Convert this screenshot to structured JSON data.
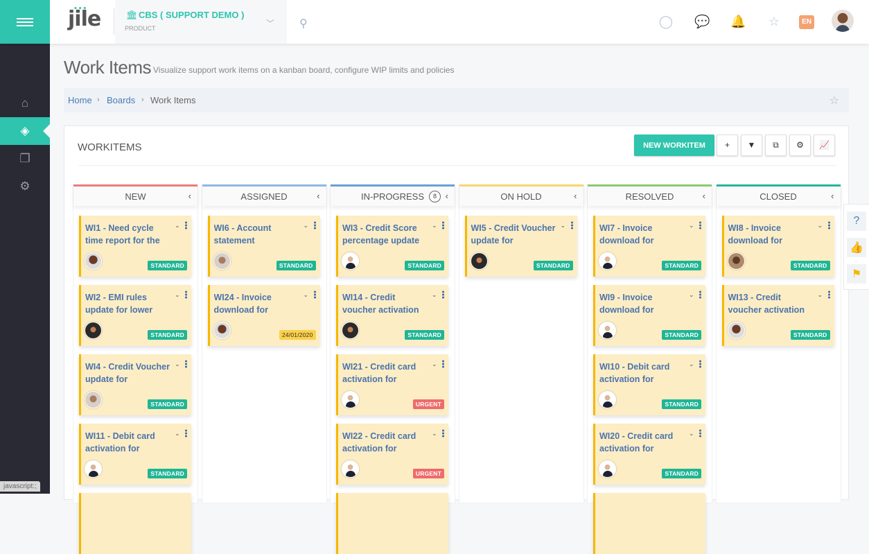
{
  "app": {
    "logo": "jile",
    "status_link": "javascript:;"
  },
  "project": {
    "name": "CBS ( SUPPORT DEMO )",
    "type": "PRODUCT"
  },
  "topbar": {
    "language": "EN",
    "icons": [
      "check-circle-icon",
      "chat-icon",
      "bell-icon",
      "star-icon"
    ]
  },
  "sidebar": {
    "items": [
      {
        "name": "home",
        "icon": "⌂",
        "active": false
      },
      {
        "name": "boards",
        "icon": "◈",
        "active": true
      },
      {
        "name": "documents",
        "icon": "❐",
        "active": false
      },
      {
        "name": "settings",
        "icon": "⚙",
        "active": false
      }
    ]
  },
  "page": {
    "title": "Work Items",
    "subtitle": "Visualize support work items on a kanban board, configure WIP limits and policies"
  },
  "breadcrumb": {
    "items": [
      "Home",
      "Boards",
      "Work Items"
    ]
  },
  "panel": {
    "title": "WORKITEMS",
    "new_button": "NEW WORKITEM",
    "toolbar": [
      {
        "name": "add",
        "glyph": "+"
      },
      {
        "name": "filter",
        "glyph": "▼"
      },
      {
        "name": "copy",
        "glyph": "⧉"
      },
      {
        "name": "settings",
        "glyph": "⚙"
      },
      {
        "name": "chart",
        "glyph": "📈"
      }
    ]
  },
  "columns": [
    {
      "title": "NEW",
      "color": "#ef7b7b",
      "count": null,
      "cards": [
        {
          "title": "WI1 - Need cycle time report for the",
          "avatar": "f1",
          "badge": "STANDARD",
          "badge_type": "standard"
        },
        {
          "title": "WI2 - EMI rules update for lower",
          "avatar": "hat",
          "badge": "STANDARD",
          "badge_type": "standard"
        },
        {
          "title": "WI4 - Credit Voucher update for",
          "avatar": "f2",
          "badge": "STANDARD",
          "badge_type": "standard"
        },
        {
          "title": "WI11 - Debit card activation for",
          "avatar": "m1",
          "badge": "STANDARD",
          "badge_type": "standard"
        }
      ]
    },
    {
      "title": "ASSIGNED",
      "color": "#8fb8e6",
      "count": null,
      "cards": [
        {
          "title": "WI6 - Account statement",
          "avatar": "f2",
          "badge": "STANDARD",
          "badge_type": "standard"
        },
        {
          "title": "WI24 - Invoice download for",
          "avatar": "f1",
          "badge": "24/01/2020",
          "badge_type": "date"
        }
      ]
    },
    {
      "title": "IN-PROGRESS",
      "color": "#6b9fd6",
      "count": "8",
      "cards": [
        {
          "title": "WI3 - Credit Score percentage update",
          "avatar": "m1",
          "badge": "STANDARD",
          "badge_type": "standard"
        },
        {
          "title": "WI14 - Credit voucher activation",
          "avatar": "hat",
          "badge": "STANDARD",
          "badge_type": "standard"
        },
        {
          "title": "WI21 - Credit card activation for",
          "avatar": "m1",
          "badge": "URGENT",
          "badge_type": "urgent"
        },
        {
          "title": "WI22 - Credit card activation for",
          "avatar": "m1",
          "badge": "URGENT",
          "badge_type": "urgent"
        }
      ]
    },
    {
      "title": "ON HOLD",
      "color": "#f7d66b",
      "count": null,
      "cards": [
        {
          "title": "WI5 - Credit Voucher update for",
          "avatar": "hat",
          "badge": "STANDARD",
          "badge_type": "standard"
        }
      ]
    },
    {
      "title": "RESOLVED",
      "color": "#8cc96f",
      "count": null,
      "cards": [
        {
          "title": "WI7 - Invoice download for",
          "avatar": "m1",
          "badge": "STANDARD",
          "badge_type": "standard"
        },
        {
          "title": "WI9 - Invoice download for",
          "avatar": "m1",
          "badge": "STANDARD",
          "badge_type": "standard"
        },
        {
          "title": "WI10 - Debit card activation for",
          "avatar": "m1",
          "badge": "STANDARD",
          "badge_type": "standard"
        },
        {
          "title": "WI20 - Credit card activation for",
          "avatar": "m1",
          "badge": "STANDARD",
          "badge_type": "standard"
        }
      ]
    },
    {
      "title": "CLOSED",
      "color": "#1fb89a",
      "count": null,
      "cards": [
        {
          "title": "WI8 - Invoice download for",
          "avatar": "f3",
          "badge": "STANDARD",
          "badge_type": "standard"
        },
        {
          "title": "WI13 - Credit voucher activation",
          "avatar": "f1",
          "badge": "STANDARD",
          "badge_type": "standard"
        }
      ]
    }
  ],
  "right_tools": [
    {
      "name": "help",
      "glyph": "?",
      "color": "#4a7cb5"
    },
    {
      "name": "like",
      "glyph": "👍",
      "color": "#2ec4ae"
    },
    {
      "name": "signpost",
      "glyph": "⚑",
      "color": "#f5b800"
    }
  ]
}
